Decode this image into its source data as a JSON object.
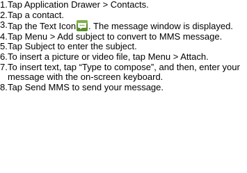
{
  "steps": [
    {
      "num": "1.",
      "text": "Tap Application Drawer > Contacts."
    },
    {
      "num": "2.",
      "text": "Tap a contact."
    },
    {
      "num": "3.",
      "text_before": "Tap the Text Icon",
      "icon": "message-text-icon",
      "text_after": ". The message window is displayed."
    },
    {
      "num": "4.",
      "text": "Tap Menu > Add subject to convert to MMS message."
    },
    {
      "num": "5.",
      "text": "Tap Subject to enter the subject."
    },
    {
      "num": "6.",
      "text": "To insert a picture or video file, tap Menu > Attach."
    },
    {
      "num": "7.",
      "text": "To insert text, tap “Type to compose”, and then, enter your message with the on-screen keyboard."
    },
    {
      "num": "8.",
      "text": "Tap Send MMS to send your message."
    }
  ],
  "colors": {
    "icon_bg": "#5a8f2e",
    "icon_bubble": "#ffffff"
  }
}
